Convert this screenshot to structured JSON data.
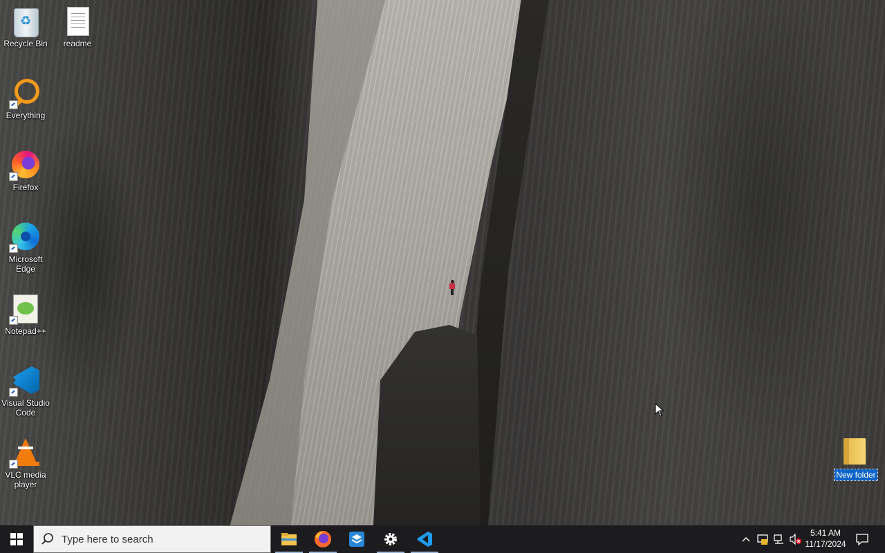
{
  "desktop": {
    "icons": [
      {
        "label": "Recycle Bin"
      },
      {
        "label": "readme"
      },
      {
        "label": "Everything"
      },
      {
        "label": "Firefox"
      },
      {
        "label": "Microsoft Edge"
      },
      {
        "label": "Notepad++"
      },
      {
        "label": "Visual Studio Code"
      },
      {
        "label": "VLC media player"
      },
      {
        "label": "New folder"
      }
    ]
  },
  "taskbar": {
    "search_placeholder": "Type here to search",
    "pinned_apps": [
      "file-explorer",
      "firefox",
      "app-installer",
      "settings",
      "visual-studio-code"
    ],
    "tray_icons": [
      "chevron-up-icon",
      "security-icon",
      "network-icon",
      "volume-muted-icon"
    ],
    "clock": {
      "time": "5:41 AM",
      "date": "11/17/2024"
    }
  },
  "colors": {
    "taskbar_bg": "#1c1c1e",
    "selection": "#0a63c9",
    "accent_blue": "#0078d7"
  }
}
